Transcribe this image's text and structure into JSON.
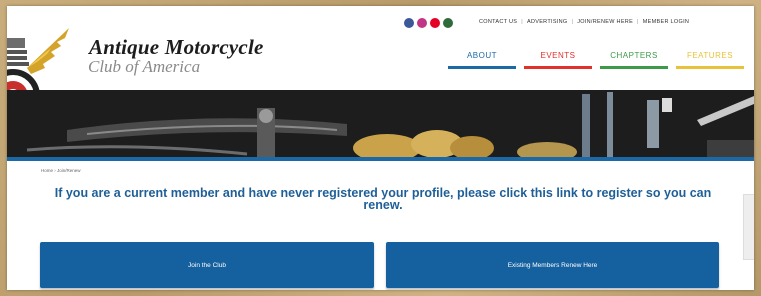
{
  "site": {
    "title": "Antique Motorcycle",
    "subtitle": "Club of America"
  },
  "utility_links": [
    "CONTACT US",
    "ADVERTISING",
    "JOIN/RENEW HERE",
    "MEMBER LOGIN"
  ],
  "social_icons": [
    {
      "name": "facebook-icon",
      "color": "#3b5998"
    },
    {
      "name": "instagram-icon",
      "color": "#c13584"
    },
    {
      "name": "pinterest-icon",
      "color": "#e60023"
    },
    {
      "name": "other-social-icon",
      "color": "#2f6b3a"
    }
  ],
  "nav": [
    {
      "label": "ABOUT",
      "color": "#1c69a6",
      "bar": "#1c69a6"
    },
    {
      "label": "EVENTS",
      "color": "#e0312b",
      "bar": "#e0312b"
    },
    {
      "label": "CHAPTERS",
      "color": "#3c9a48",
      "bar": "#3c9a48"
    },
    {
      "label": "FEATURES",
      "color": "#e9c23b",
      "bar": "#e9c23b"
    }
  ],
  "breadcrumb": "Home › Join/Renew",
  "headline": "If you are a current member and have never registered your profile, please click this link to register so you can renew.",
  "buttons": {
    "join": "Join the Club",
    "renew": "Existing Members Renew Here"
  },
  "colors": {
    "accent": "#15609e",
    "headline": "#1f5f97"
  }
}
